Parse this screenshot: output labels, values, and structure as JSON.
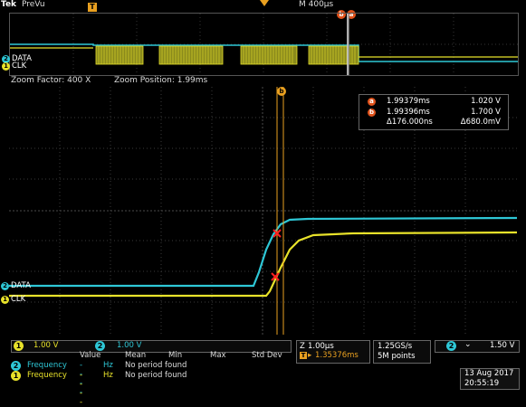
{
  "header": {
    "brand": "Tek",
    "mode": "PreVu",
    "timebase": "M 400µs"
  },
  "zoom": {
    "factor": "Zoom Factor: 400 X",
    "position": "Zoom Position: 1.99ms"
  },
  "channels": {
    "data_label": "DATA",
    "clk_label": "CLK",
    "ch1_num": "1",
    "ch2_num": "2"
  },
  "cursors": {
    "a_label": "a",
    "b_label": "b",
    "a_time": "1.99379ms",
    "a_value": "1.020 V",
    "b_time": "1.99396ms",
    "b_value": "1.700 V",
    "delta_time": "Δ176.000ns",
    "delta_value": "Δ680.0mV"
  },
  "trigger_marker": "T",
  "status": {
    "ch1_scale": "1.00 V",
    "ch2_scale": "1.00 V",
    "horizontal_scale": "1.00µs",
    "horizontal_position": "1.35376ms",
    "sample_rate": "1.25GS/s",
    "record_length": "5M points",
    "trigger_channel": "2",
    "trigger_level": "1.50 V"
  },
  "measurements": {
    "headers": [
      "Value",
      "Mean",
      "Min",
      "Max",
      "Std Dev"
    ],
    "rows": [
      {
        "channel": "2",
        "name": "Frequency",
        "value": "Hz",
        "note": "No period found"
      },
      {
        "channel": "1",
        "name": "Frequency",
        "value": "Hz",
        "note": "No period found"
      }
    ]
  },
  "datetime": {
    "date": "13 Aug 2017",
    "time": "20:55:19"
  },
  "colors": {
    "ch1": "#e8e22a",
    "ch2": "#2ec7d6",
    "cursor": "#e0521b",
    "marker": "#e9a020"
  }
}
